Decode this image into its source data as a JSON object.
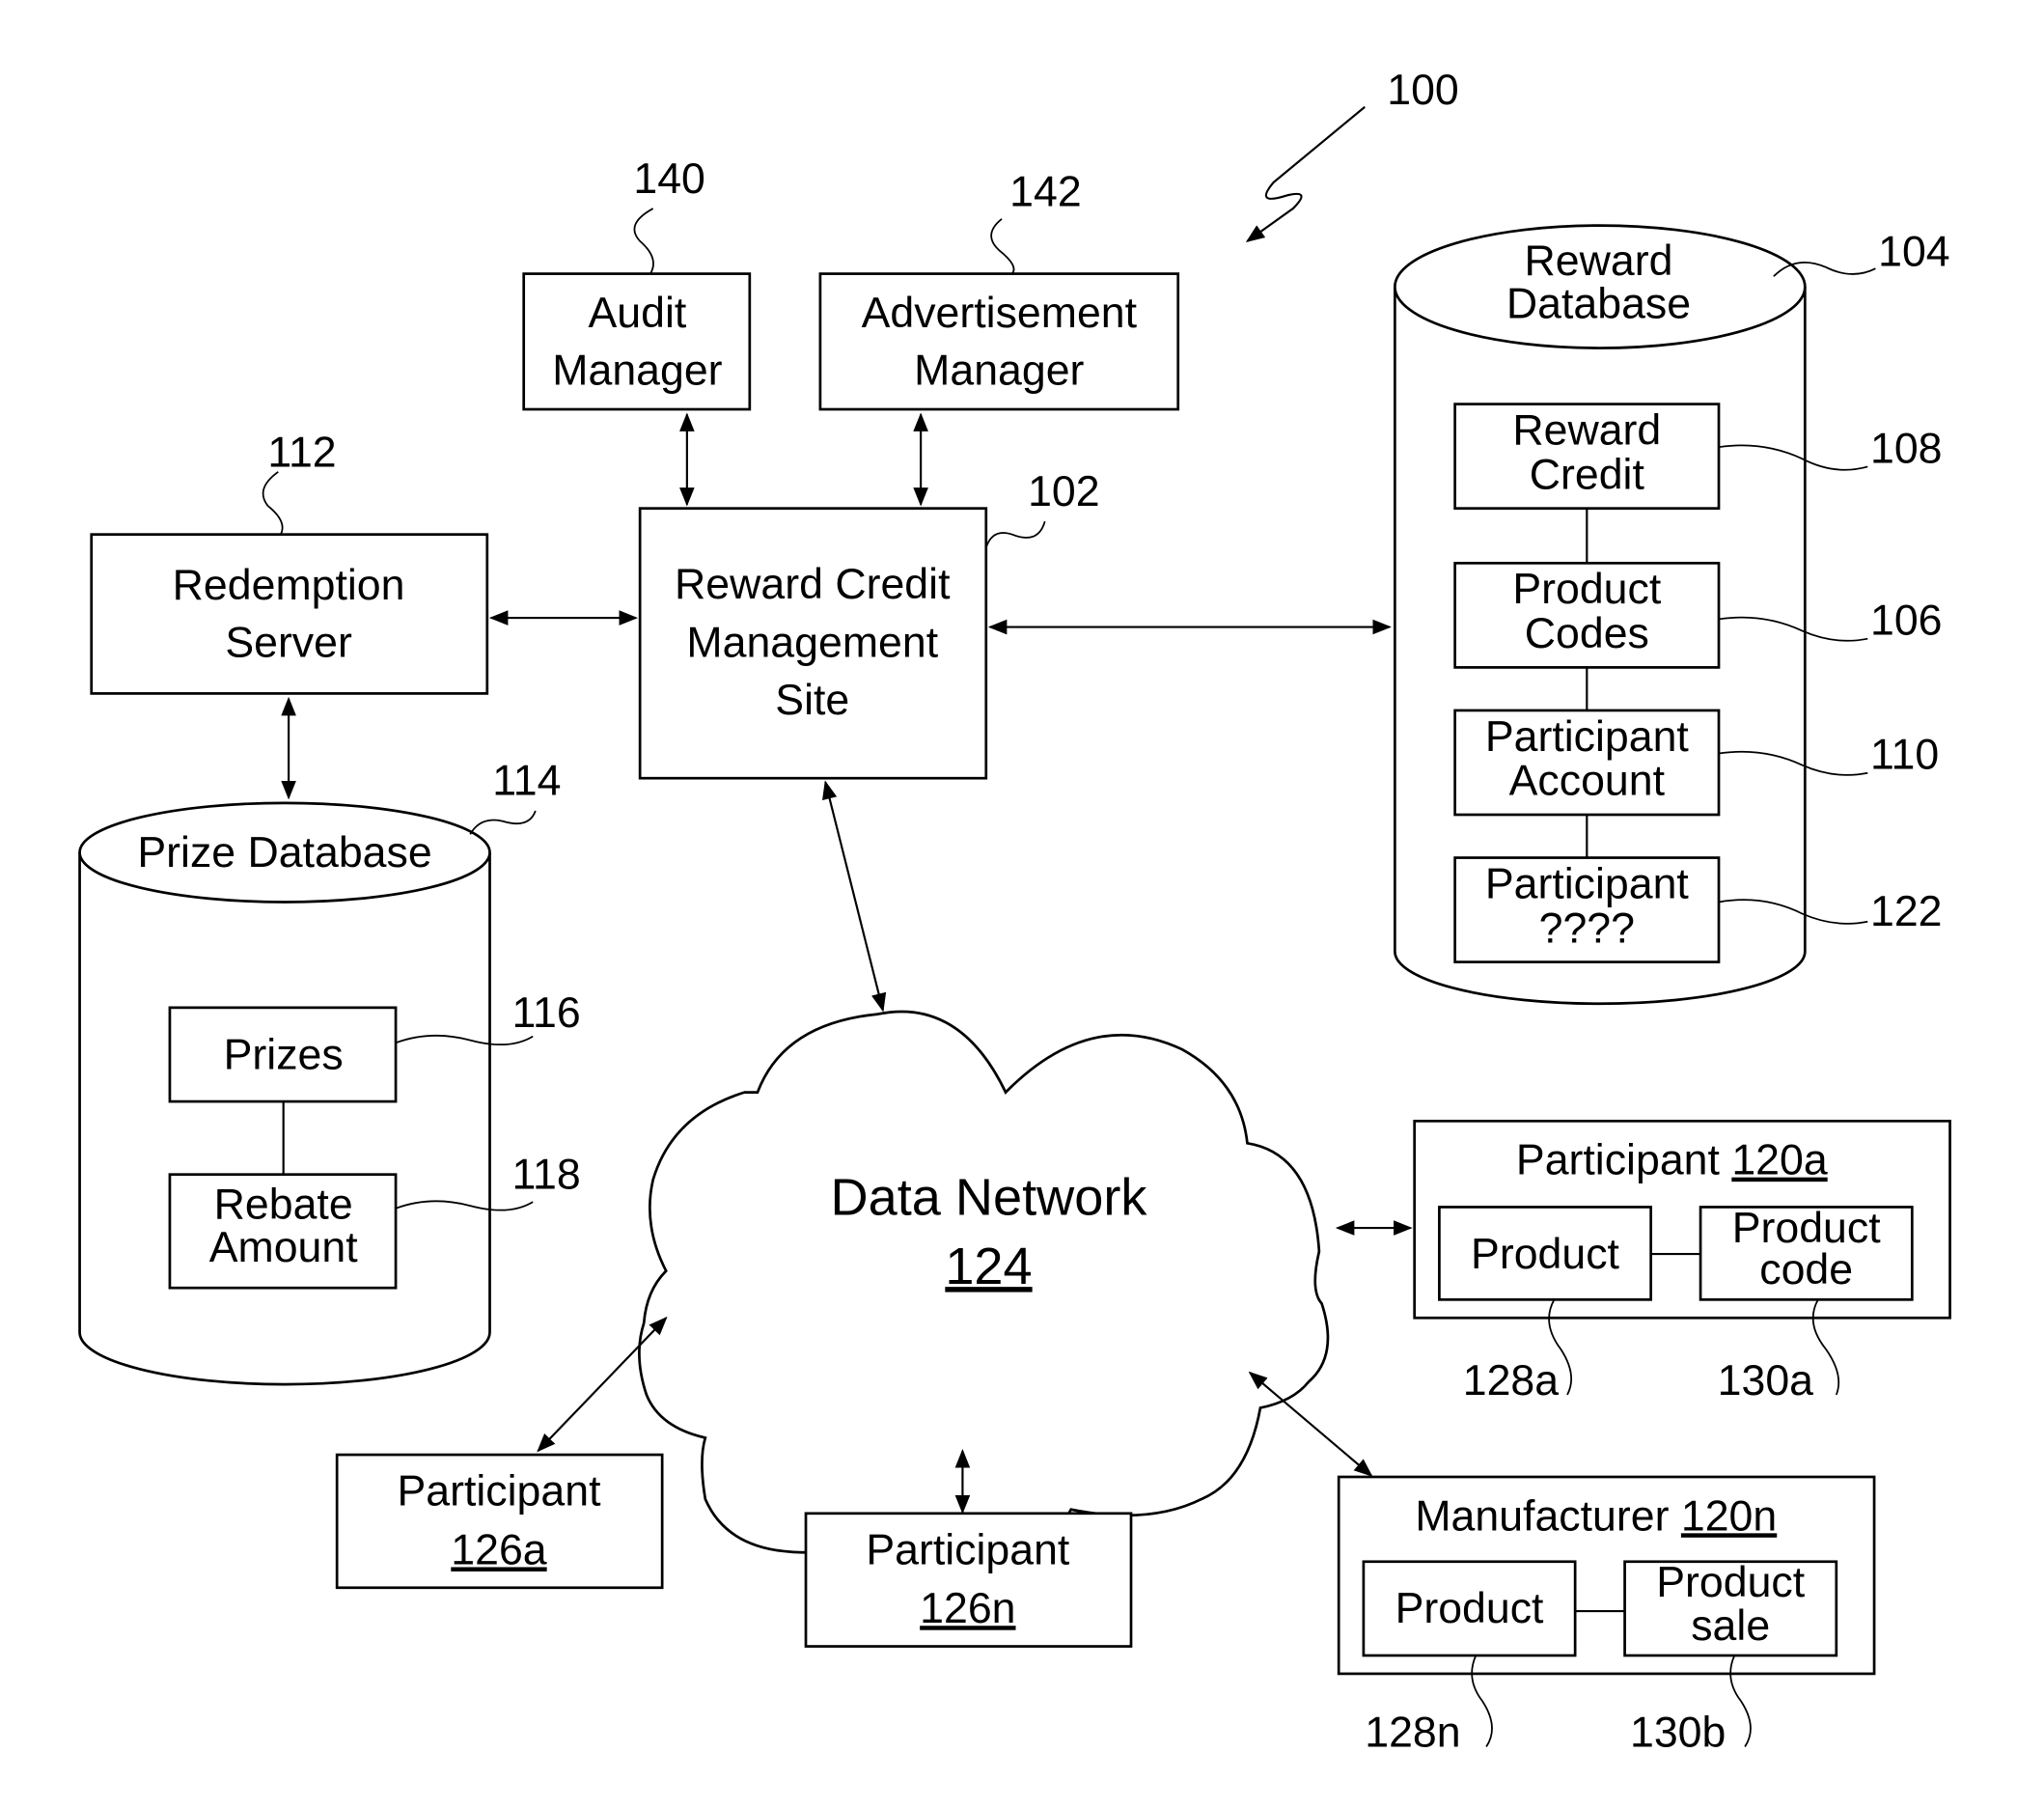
{
  "figure_ref": "100",
  "audit_manager": {
    "line1": "Audit",
    "line2": "Manager",
    "ref": "140"
  },
  "advertisement_manager": {
    "line1": "Advertisement",
    "line2": "Manager",
    "ref": "142"
  },
  "redemption_server": {
    "line1": "Redemption",
    "line2": "Server",
    "ref": "112"
  },
  "reward_credit_site": {
    "line1": "Reward Credit",
    "line2": "Management",
    "line3": "Site",
    "ref": "102"
  },
  "reward_database": {
    "line1": "Reward",
    "line2": "Database",
    "ref": "104",
    "items": [
      {
        "line1": "Reward",
        "line2": "Credit",
        "ref": "108"
      },
      {
        "line1": "Product",
        "line2": "Codes",
        "ref": "106"
      },
      {
        "line1": "Participant",
        "line2": "Account",
        "ref": "110"
      },
      {
        "line1": "Participant",
        "line2": "????",
        "ref": "122"
      }
    ]
  },
  "prize_database": {
    "title": "Prize Database",
    "ref": "114",
    "items": [
      {
        "line1": "Prizes",
        "ref": "116"
      },
      {
        "line1": "Rebate",
        "line2": "Amount",
        "ref": "118"
      }
    ]
  },
  "data_network": {
    "label": "Data Network",
    "ref": "124"
  },
  "participant_120a": {
    "label": "Participant",
    "ref": "120a",
    "product": {
      "label": "Product",
      "ref": "128a"
    },
    "product_code": {
      "line1": "Product",
      "line2": "code",
      "ref": "130a"
    }
  },
  "manufacturer_120n": {
    "label": "Manufacturer",
    "ref": "120n",
    "product": {
      "label": "Product",
      "ref": "128n"
    },
    "product_sale": {
      "line1": "Product",
      "line2": "sale",
      "ref": "130b"
    }
  },
  "participant_126a": {
    "label": "Participant",
    "ref": "126a"
  },
  "participant_126n": {
    "label": "Participant",
    "ref": "126n"
  }
}
